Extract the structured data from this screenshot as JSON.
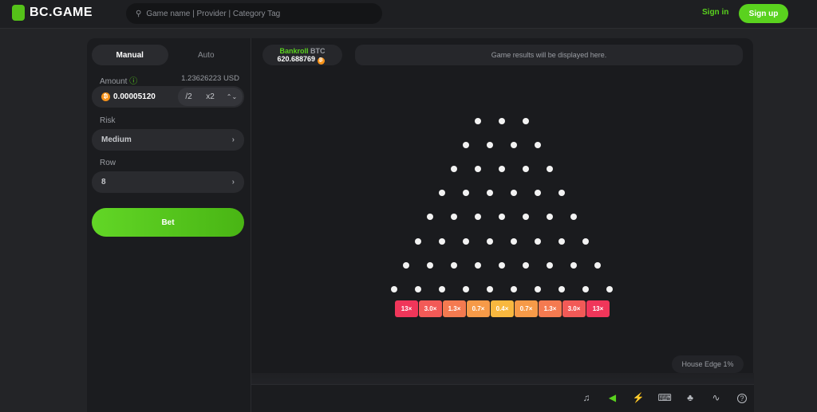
{
  "header": {
    "logo": "BC.GAME",
    "search_placeholder": "Game name | Provider | Category Tag",
    "signin": "Sign in",
    "signup": "Sign up"
  },
  "panel": {
    "tabs": [
      {
        "label": "Manual",
        "active": true
      },
      {
        "label": "Auto",
        "active": false
      }
    ],
    "amount_label": "Amount",
    "amount_usd": "1.23626223 USD",
    "amount_value": "0.00005120",
    "half": "/2",
    "double": "x2",
    "risk_label": "Risk",
    "risk_value": "Medium",
    "row_label": "Row",
    "row_value": "8",
    "bet": "Bet"
  },
  "game": {
    "bankroll_label": "Bankroll",
    "bankroll_currency": "BTC",
    "bankroll_value": "620.688769",
    "results": "Game results will be displayed here.",
    "multipliers": [
      "13×",
      "3.0×",
      "1.3×",
      "0.7×",
      "0.4×",
      "0.7×",
      "1.3×",
      "3.0×",
      "13×"
    ],
    "bucket_colors": [
      "#f0365a",
      "#f25a57",
      "#f47a50",
      "#f69a48",
      "#f8b83f",
      "#f69a48",
      "#f47a50",
      "#f25a57",
      "#f0365a"
    ],
    "house_edge": "House Edge 1%",
    "toolbar_icons": [
      "music-icon",
      "sound-icon",
      "lightning-icon",
      "keyboard-icon",
      "acorn-icon",
      "chart-icon",
      "help-icon"
    ]
  },
  "colors": {
    "accent": "#5ad21e",
    "background": "#232427"
  }
}
